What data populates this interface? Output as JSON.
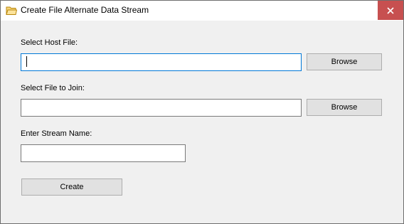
{
  "window": {
    "title": "Create File Alternate Data Stream",
    "icon": "folder-icon",
    "close_label": "✕"
  },
  "form": {
    "host_file": {
      "label": "Select Host File:",
      "value": "",
      "browse_label": "Browse",
      "focused": true
    },
    "join_file": {
      "label": "Select File to Join:",
      "value": "",
      "browse_label": "Browse"
    },
    "stream_name": {
      "label": "Enter Stream Name:",
      "value": ""
    },
    "create_label": "Create"
  },
  "colors": {
    "window_background": "#f0f0f0",
    "close_button": "#c75050",
    "focus_border": "#0078d7",
    "folder_icon": "#e8b53a"
  }
}
